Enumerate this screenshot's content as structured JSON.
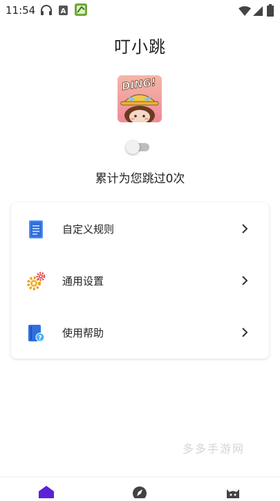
{
  "status_bar": {
    "time": "11:54",
    "left_icons": [
      "headphones-icon",
      "a-notification-icon",
      "app-notification-icon"
    ],
    "right_icons": [
      "wifi-icon",
      "cellular-signal-icon",
      "battery-icon"
    ]
  },
  "app": {
    "title": "叮小跳",
    "logo_text": "DING!",
    "skip_count_text": "累计为您跳过0次",
    "toggle_on": false
  },
  "menu": [
    {
      "label": "自定义规则",
      "icon": "document-icon"
    },
    {
      "label": "通用设置",
      "icon": "gears-icon"
    },
    {
      "label": "使用帮助",
      "icon": "help-book-icon"
    }
  ],
  "watermark": "多多手游网",
  "bottom_nav": [
    {
      "icon": "home-icon",
      "active": true
    },
    {
      "icon": "rocket-icon",
      "active": false
    },
    {
      "icon": "cat-icon",
      "active": false
    }
  ],
  "colors": {
    "accent": "#5b22d6",
    "text": "#222222",
    "icon_gray": "#424242"
  }
}
